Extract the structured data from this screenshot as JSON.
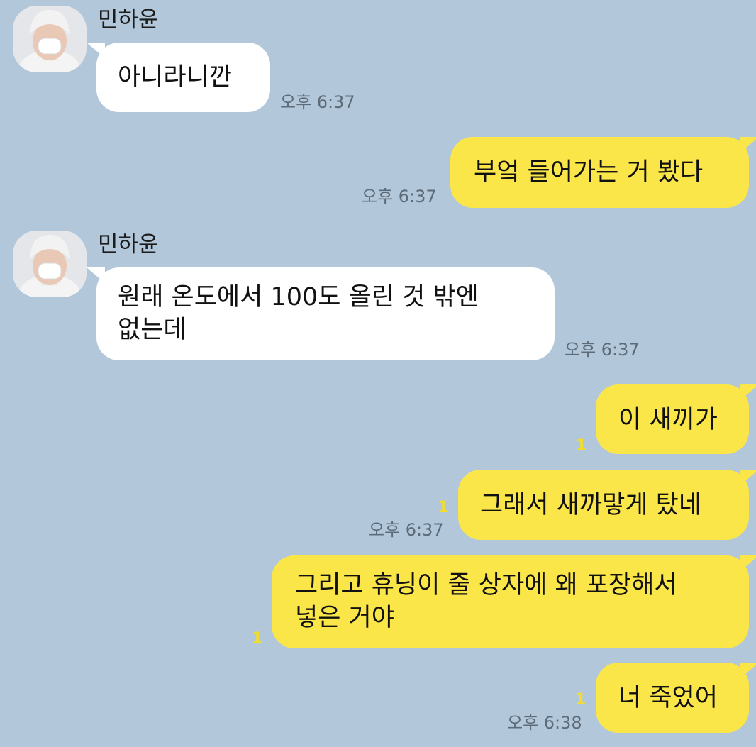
{
  "messages": [
    {
      "type": "in",
      "sender": "민하윤",
      "text": "아니라니깐",
      "time": "오후 6:37"
    },
    {
      "type": "out",
      "text": "부엌 들어가는 거 봤다",
      "time": "오후 6:37"
    },
    {
      "type": "in",
      "sender": "민하윤",
      "lines": [
        "원래 온도에서 100도 올린 것 밖엔",
        "없는데"
      ],
      "time": "오후 6:37"
    },
    {
      "type": "out",
      "text": "이 새끼가",
      "unread": "1"
    },
    {
      "type": "out",
      "text": "그래서 새까맣게 탔네",
      "unread": "1",
      "time": "오후 6:37"
    },
    {
      "type": "out",
      "lines": [
        "그리고 휴닝이 줄 상자에 왜 포장해서",
        "넣은 거야"
      ],
      "unread": "1"
    },
    {
      "type": "out",
      "text": "너 죽었어",
      "unread": "1",
      "time": "오후 6:38"
    }
  ],
  "colors": {
    "background": "#b2c7da",
    "outgoing_bubble": "#fbe64a",
    "incoming_bubble": "#ffffff",
    "unread_count": "#f2dd2c"
  },
  "icons": {
    "avatar": "profile-photo-avatar"
  }
}
